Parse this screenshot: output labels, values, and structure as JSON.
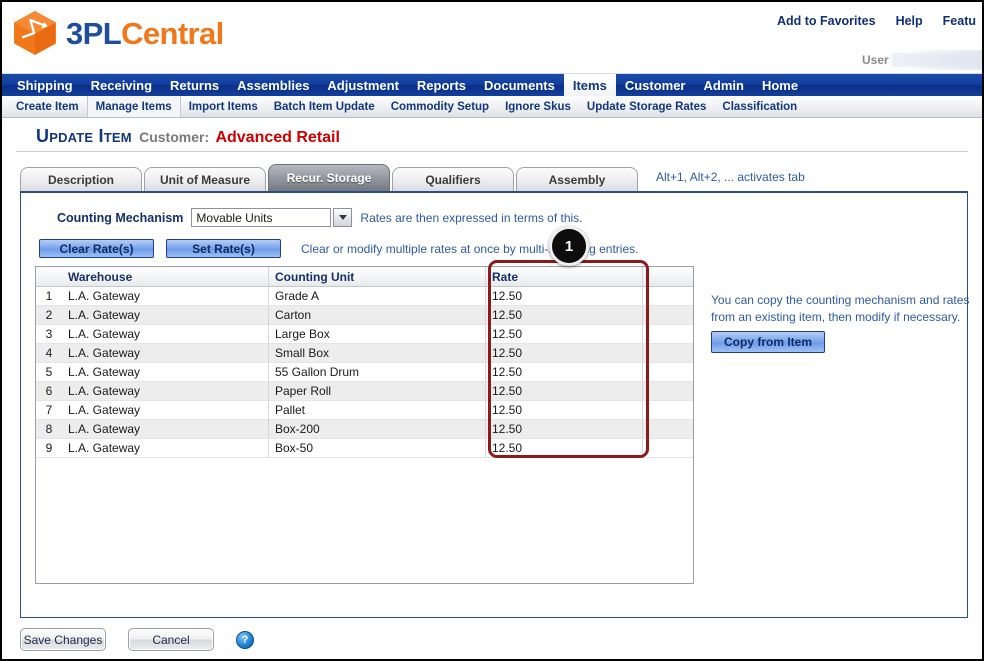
{
  "brand": {
    "name_primary": "3PL",
    "name_secondary": "Central",
    "colors": {
      "blue": "#1f4e9c",
      "orange": "#f0771a",
      "nav_blue": "#12409e",
      "accent_red": "#cc0000",
      "highlight_red": "#8b1a1a"
    }
  },
  "header": {
    "links": [
      {
        "label": "Add to Favorites"
      },
      {
        "label": "Help"
      },
      {
        "label": "Featu"
      }
    ],
    "user_label": "User"
  },
  "main_nav": {
    "items": [
      {
        "label": "Shipping",
        "active": false
      },
      {
        "label": "Receiving",
        "active": false
      },
      {
        "label": "Returns",
        "active": false
      },
      {
        "label": "Assemblies",
        "active": false
      },
      {
        "label": "Adjustment",
        "active": false
      },
      {
        "label": "Reports",
        "active": false
      },
      {
        "label": "Documents",
        "active": false
      },
      {
        "label": "Items",
        "active": true
      },
      {
        "label": "Customer",
        "active": false
      },
      {
        "label": "Admin",
        "active": false
      },
      {
        "label": "Home",
        "active": false
      }
    ]
  },
  "sub_nav": {
    "items": [
      {
        "label": "Create Item",
        "active": false
      },
      {
        "label": "Manage Items",
        "active": true
      },
      {
        "label": "Import Items",
        "active": false
      },
      {
        "label": "Batch Item Update",
        "active": false
      },
      {
        "label": "Commodity Setup",
        "active": false
      },
      {
        "label": "Ignore Skus",
        "active": false
      },
      {
        "label": "Update Storage Rates",
        "active": false
      },
      {
        "label": "Classification",
        "active": false
      }
    ]
  },
  "page_title": {
    "action": "Update Item",
    "customer_label": "Customer:",
    "customer_name": "Advanced Retail"
  },
  "tabs": {
    "items": [
      {
        "label": "Description",
        "active": false
      },
      {
        "label": "Unit of Measure",
        "active": false
      },
      {
        "label": "Recur. Storage",
        "active": true
      },
      {
        "label": "Qualifiers",
        "active": false
      },
      {
        "label": "Assembly",
        "active": false
      }
    ],
    "hint": "Alt+1, Alt+2, ... activates tab"
  },
  "counting_mechanism": {
    "label": "Counting Mechanism",
    "value": "Movable Units",
    "hint": "Rates are then expressed in terms of this."
  },
  "rate_actions": {
    "clear_label": "Clear Rate(s)",
    "set_label": "Set Rate(s)",
    "hint": "Clear or modify multiple rates at once by multi-selecting entries."
  },
  "callout": {
    "number": "1"
  },
  "grid": {
    "columns": [
      "",
      "Warehouse",
      "Counting Unit",
      "Rate",
      ""
    ],
    "rows": [
      {
        "num": "1",
        "warehouse": "L.A. Gateway",
        "counting_unit": "Grade A",
        "rate": "12.50"
      },
      {
        "num": "2",
        "warehouse": "L.A. Gateway",
        "counting_unit": "Carton",
        "rate": "12.50"
      },
      {
        "num": "3",
        "warehouse": "L.A. Gateway",
        "counting_unit": "Large Box",
        "rate": "12.50"
      },
      {
        "num": "4",
        "warehouse": "L.A. Gateway",
        "counting_unit": "Small Box",
        "rate": "12.50"
      },
      {
        "num": "5",
        "warehouse": "L.A. Gateway",
        "counting_unit": "55 Gallon Drum",
        "rate": "12.50"
      },
      {
        "num": "6",
        "warehouse": "L.A. Gateway",
        "counting_unit": "Paper Roll",
        "rate": "12.50"
      },
      {
        "num": "7",
        "warehouse": "L.A. Gateway",
        "counting_unit": "Pallet",
        "rate": "12.50"
      },
      {
        "num": "8",
        "warehouse": "L.A. Gateway",
        "counting_unit": "Box-200",
        "rate": "12.50"
      },
      {
        "num": "9",
        "warehouse": "L.A. Gateway",
        "counting_unit": "Box-50",
        "rate": "12.50"
      }
    ]
  },
  "right_help": {
    "line1": "You can copy the counting mechanism and rates",
    "line2": "from an existing item, then modify if necessary.",
    "copy_button": "Copy from Item"
  },
  "footer": {
    "save_label": "Save Changes",
    "cancel_label": "Cancel",
    "help_glyph": "?"
  }
}
